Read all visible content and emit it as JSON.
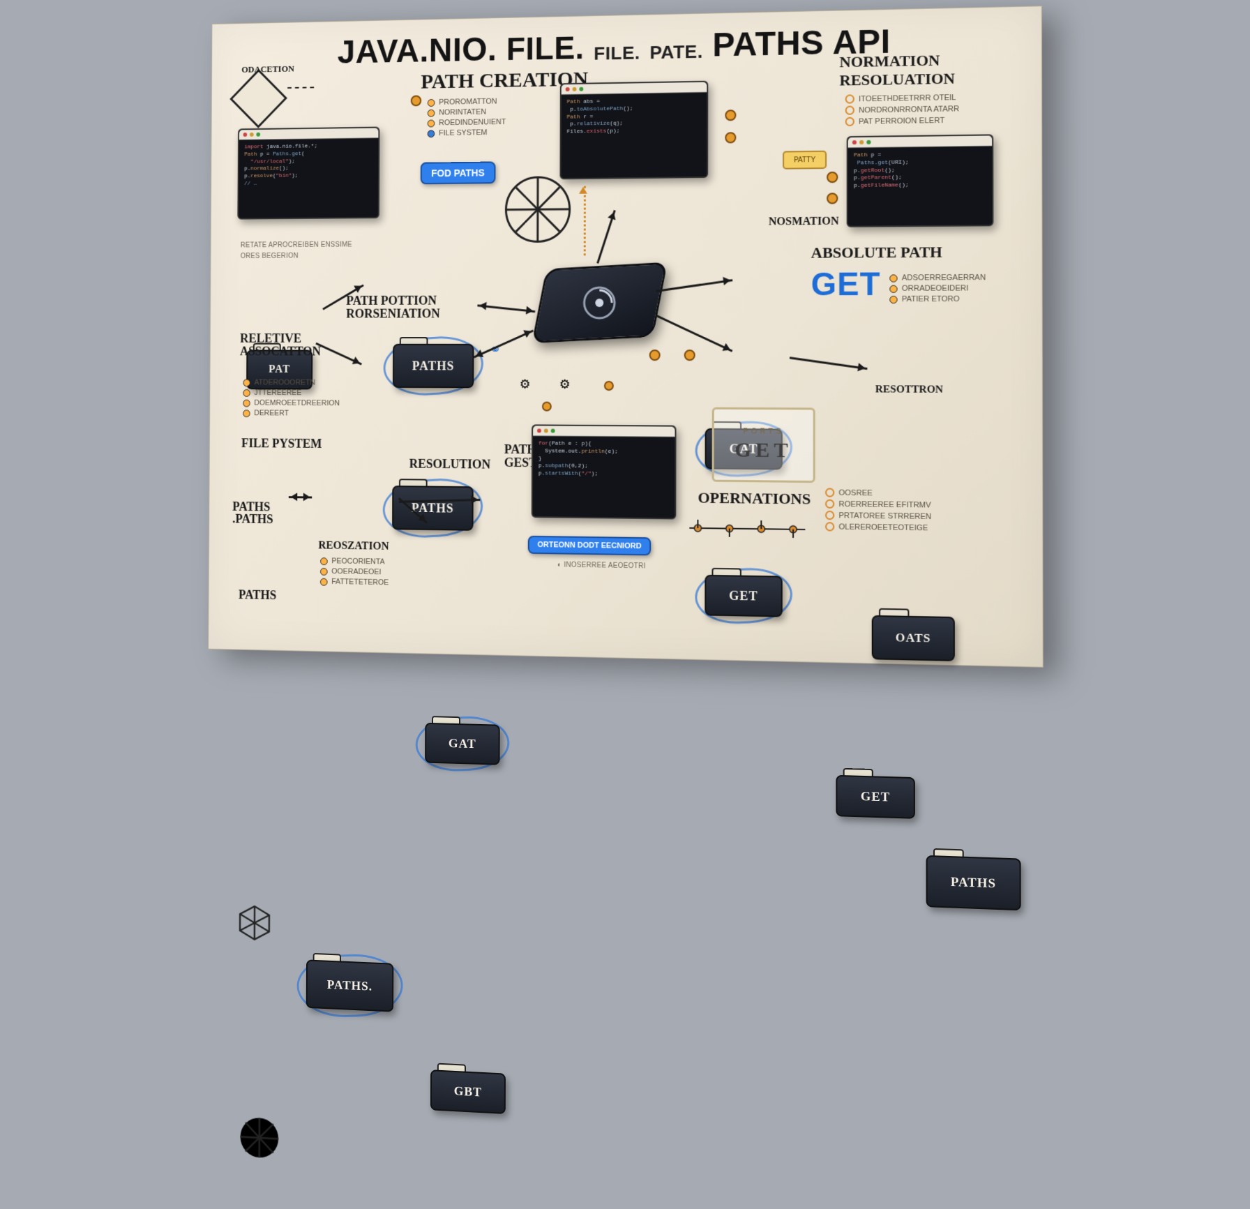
{
  "title_parts": {
    "a": "JAVA.",
    "b": "NIO.",
    "c": "FILE.",
    "d": "FILE.",
    "e": "PATE.",
    "f": "PATHS API"
  },
  "headings": {
    "path_creation": "PATH CREATION",
    "normation": "NORMATION",
    "resolution": "RESOLUATION",
    "absolute_path": "ABSOLUTE PATH",
    "path_portion": "PATH POTTION\nRORSENIATION",
    "relative": "RELETIVE\nASSOCATTON",
    "file_system": "FILE PYSTEM",
    "resolution2": "RESOLUTION",
    "paths_gestion": "PATHS.\nGESTION",
    "operations": "OPERNATIONS",
    "nosmation": "NOSMATION",
    "odaetion": "ODACETION",
    "left_res": "RETATE APROCREIBEN ENSSIME ORES BEGERION",
    "reoszation": "REOSZATION",
    "resottron": "RESOTTRON",
    "paths_label": "PATHS\n.PATHS",
    "paths_logo": "PATHS",
    "get_big": "GET"
  },
  "folders": {
    "paths1": "PATHS",
    "paths2": "PATHS",
    "paths3": "PATHS.",
    "paths4": "PATHS",
    "get1": "GAT",
    "get2": "GET",
    "get3": "GBT",
    "get4": "GET",
    "get5": "OATS",
    "pat": "PAT"
  },
  "pills": {
    "paths": "FOD PATHS",
    "badge": "ORTEONN DODT EECNIORD"
  },
  "bullets_creation": [
    "PROROMATTON",
    "NORINTATEN",
    "ROEDINDENUIENT",
    "FILE SYSTEM"
  ],
  "bullets_left": [
    "ATDEROOORETN",
    "JTTEREEREE",
    "DOEMROEETDREERION",
    "DEREERT"
  ],
  "bullets_normation": [
    "ITOEETHDEETRRR OTEIL",
    "NORDRONRRONTA ATARR",
    "PAT PERROION ELERT"
  ],
  "bullets_absolute": [
    "ADSOERREGAERRAN",
    "ORRADEOEIDERI",
    "PATIER ETORO"
  ],
  "bullets_reosz": [
    "PEOCORIENTA",
    "OOERADEOEI",
    "FATTETETEROE"
  ],
  "bullets_ops": [
    "OOSREE",
    "ROERREEREE EFITRMV",
    "PRTATOREE STRREREN",
    "OLEREROEETEOTEIGE"
  ],
  "bullets_footer": "INOSERREE  AEOEOTRI",
  "lightbox": {
    "top": "PORTS",
    "text": "GET"
  }
}
